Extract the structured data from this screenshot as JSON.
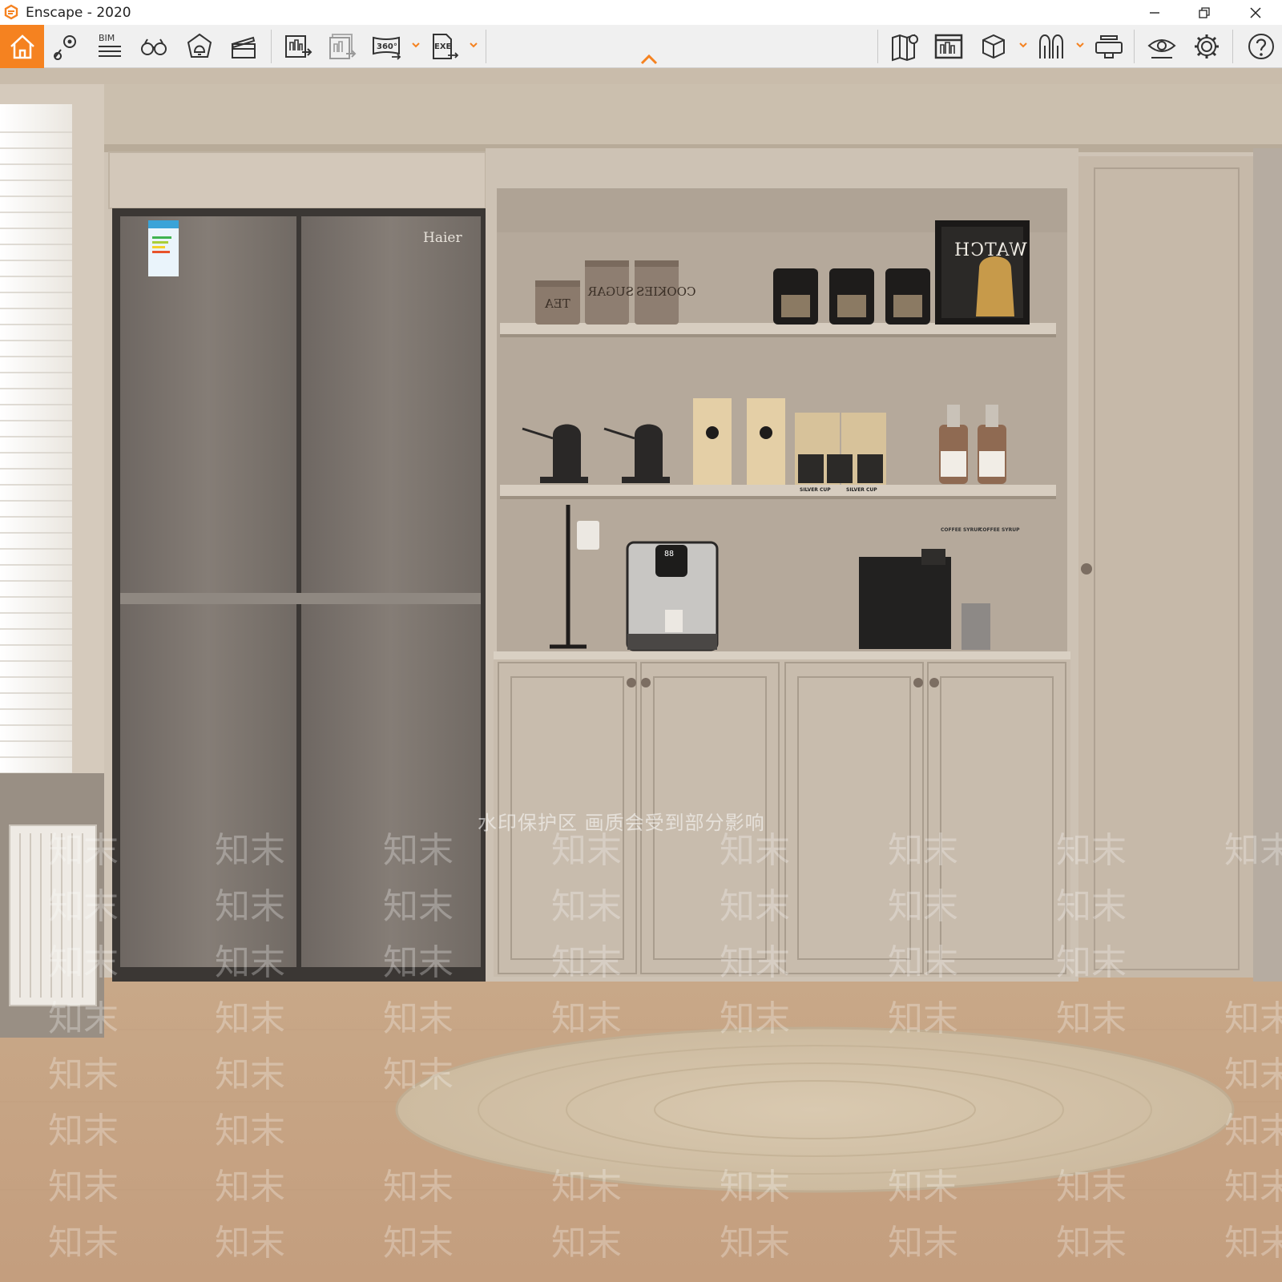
{
  "window": {
    "title": "Enscape - 2020",
    "accent_color": "#f58220",
    "controls": [
      "minimize-icon",
      "restore-icon",
      "close-icon"
    ]
  },
  "toolbar": {
    "left_tools": [
      {
        "name": "home",
        "icon": "home-icon",
        "active": true
      },
      {
        "name": "views",
        "icon": "map-pin-icon"
      },
      {
        "name": "bim",
        "icon": "bim-icon",
        "text": "BIM"
      },
      {
        "name": "walk-mode",
        "icon": "binoculars-icon"
      },
      {
        "name": "sound",
        "icon": "bell-icon"
      },
      {
        "name": "video-editor",
        "icon": "clapperboard-icon"
      },
      {
        "name": "render-image",
        "icon": "render-image-icon"
      },
      {
        "name": "batch-render",
        "icon": "batch-render-icon"
      },
      {
        "name": "panorama",
        "icon": "panorama-icon",
        "text": "360°"
      },
      {
        "name": "export",
        "icon": "exe-export-icon",
        "text": "EXE"
      }
    ],
    "right_tools": [
      {
        "name": "map",
        "icon": "map-icon"
      },
      {
        "name": "render-window",
        "icon": "render-window-icon"
      },
      {
        "name": "asset-library",
        "icon": "cube-icon"
      },
      {
        "name": "material-editor",
        "icon": "tree-icon"
      },
      {
        "name": "vr-headset",
        "icon": "vr-headset-icon"
      },
      {
        "name": "visual-settings",
        "icon": "eye-icon"
      },
      {
        "name": "general-settings",
        "icon": "gear-icon"
      },
      {
        "name": "help",
        "icon": "help-icon"
      }
    ],
    "collapse_icon": "chevron-up-icon"
  },
  "scene": {
    "fridge_brand": "Haier",
    "jar_labels": [
      "TEA",
      "SUGAR",
      "COOKIES"
    ],
    "poster_text": "WATCH",
    "syrup_labels": [
      "COFFEE SYRUP",
      "COFFEE SYRUP"
    ],
    "bag_labels": [
      "SILVER CUP",
      "SILVER CUP"
    ],
    "dispenser_readout": "88"
  },
  "watermark": {
    "band_text": "水印保护区  画质会受到部分影响",
    "tile_text": "知末"
  }
}
